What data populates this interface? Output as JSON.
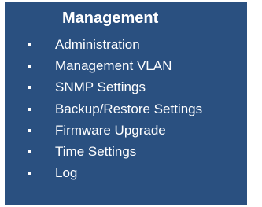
{
  "colors": {
    "panel_background": "#2a5080",
    "text": "#ffffff"
  },
  "menu": {
    "title": "Management",
    "items": [
      {
        "label": "Administration",
        "icon": "bullet-icon"
      },
      {
        "label": "Management VLAN",
        "icon": "bullet-icon"
      },
      {
        "label": "SNMP Settings",
        "icon": "bullet-icon"
      },
      {
        "label": "Backup/Restore Settings",
        "icon": "bullet-icon"
      },
      {
        "label": "Firmware Upgrade",
        "icon": "bullet-icon"
      },
      {
        "label": "Time Settings",
        "icon": "bullet-icon"
      },
      {
        "label": "Log",
        "icon": "bullet-icon"
      }
    ]
  }
}
